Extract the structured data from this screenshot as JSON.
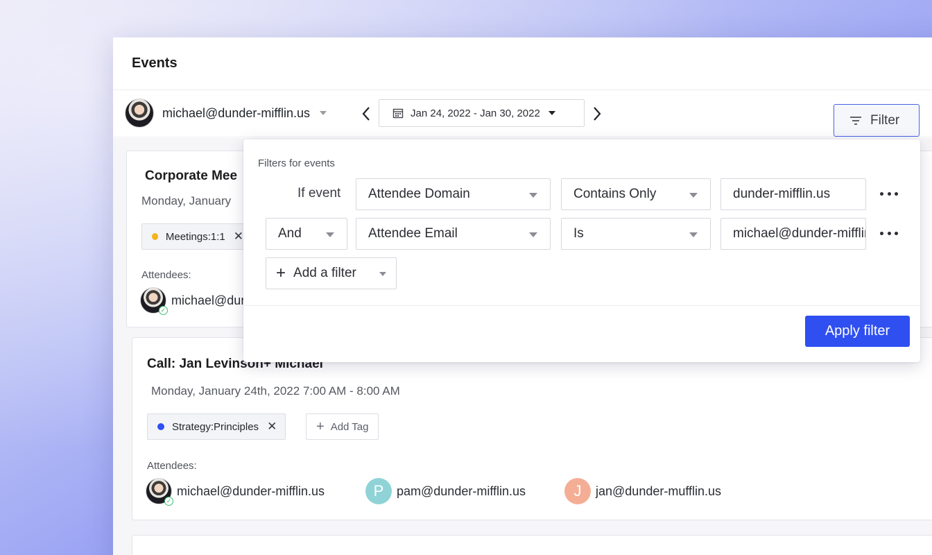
{
  "page": {
    "title": "Events"
  },
  "toolbar": {
    "user_email": "michael@dunder-mifflin.us",
    "date_range": "Jan 24, 2022 - Jan 30, 2022",
    "filter_label": "Filter"
  },
  "cards": [
    {
      "title": "Corporate Mee",
      "date": "Monday, January",
      "tags": [
        {
          "label": "Meetings:1:1",
          "color": "#f2b51c"
        }
      ],
      "attendees_label": "Attendees:",
      "attendees": [
        {
          "email": "michael@dur",
          "avatar": "photo"
        }
      ]
    },
    {
      "title": "Call: Jan Levinson+ Michael",
      "date": "Monday, January 24th, 2022 7:00 AM - 8:00 AM",
      "tags": [
        {
          "label": "Strategy:Principles",
          "color": "#2f4ff0"
        }
      ],
      "add_tag_label": "Add Tag",
      "attendees_label": "Attendees:",
      "attendees": [
        {
          "email": "michael@dunder-mifflin.us",
          "avatar": "photo"
        },
        {
          "email": "pam@dunder-mifflin.us",
          "initial": "P",
          "avatar_color": "#8fd3d6"
        },
        {
          "email": "jan@dunder-mufflin.us",
          "initial": "J",
          "avatar_color": "#f4ae95"
        }
      ]
    }
  ],
  "filter_panel": {
    "heading": "Filters for events",
    "rows": [
      {
        "prefix": "If event",
        "field": "Attendee Domain",
        "operator": "Contains Only",
        "value": "dunder-mifflin.us"
      },
      {
        "prefix": "And",
        "field": "Attendee Email",
        "operator": "Is",
        "value": "michael@dunder-mifflin.us"
      }
    ],
    "add_filter_label": "Add a filter",
    "apply_label": "Apply filter"
  },
  "colors": {
    "accent": "#2f4ff0"
  },
  "icons": [
    "chevron-left-icon",
    "chevron-right-icon",
    "calendar-icon",
    "filter-lines-icon",
    "plus-icon",
    "close-icon",
    "more-horizontal-icon",
    "check-icon"
  ]
}
